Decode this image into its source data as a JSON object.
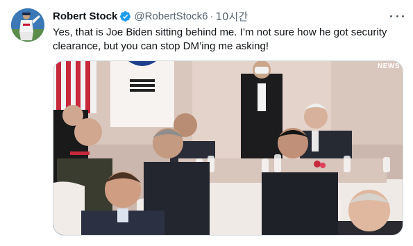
{
  "tweet": {
    "author_name": "Robert Stock",
    "handle": "@RobertStock6",
    "separator": "·",
    "time": "10시간",
    "text": "Yes, that is Joe Biden sitting behind me. I’m not sure how he got security clearance, but you can stop DM’ing me asking!",
    "media_badge": "NEWS"
  },
  "icons": {
    "verified": "verified-badge-icon",
    "more": "more-options-icon"
  },
  "colors": {
    "verified_blue": "#1d9bf0",
    "secondary_text": "#536471",
    "primary_text": "#0f1419"
  }
}
